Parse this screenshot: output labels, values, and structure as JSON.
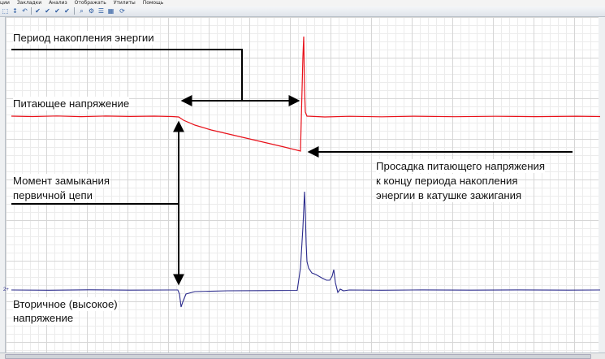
{
  "menubar": {
    "items": [
      "ции",
      "Закладки",
      "Анализ",
      "Отображать",
      "Утилиты",
      "Помощь"
    ]
  },
  "toolbar": {
    "icons": [
      "select-tool-icon",
      "measure-tool-icon",
      "undo-icon",
      "check-icon",
      "check-icon",
      "check-icon",
      "check-icon",
      "zoom-icon",
      "settings-icon",
      "channels-icon",
      "layout-icon",
      "refresh-icon"
    ]
  },
  "annotations": {
    "energy_period": "Период накопления энергии",
    "supply_voltage": "Питающее напряжение",
    "primary_close_line1": "Момент замыкания",
    "primary_close_line2": "первичной цепи",
    "sag_line1": "Просадка питающего напряжения",
    "sag_line2": "к концу периода накопления",
    "sag_line3": "энергии в катушке зажигания",
    "secondary_line1": "Вторичное (высокое)",
    "secondary_line2": "напряжение"
  },
  "channel_marker": "2+",
  "colors": {
    "supply_trace": "#e8111a",
    "secondary_trace": "#2b2b8c",
    "annotation_lines": "#000000",
    "grid": "#d6d6d6"
  }
}
